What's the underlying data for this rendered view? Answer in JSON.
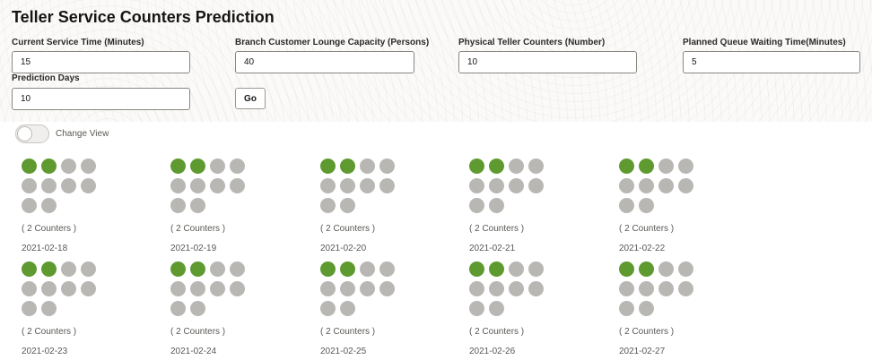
{
  "page": {
    "title": "Teller Service Counters Prediction"
  },
  "form": {
    "service_time": {
      "label": "Current Service Time (Minutes)",
      "value": "15"
    },
    "lounge_capacity": {
      "label": "Branch Customer Lounge Capacity (Persons)",
      "value": "40"
    },
    "teller_counters": {
      "label": "Physical Teller Counters (Number)",
      "value": "10"
    },
    "queue_wait": {
      "label": "Planned Queue Waiting Time(Minutes)",
      "value": "5"
    },
    "prediction_days": {
      "label": "Prediction Days",
      "value": "10"
    },
    "go_label": "Go"
  },
  "view_toggle": {
    "label": "Change View",
    "checked": false
  },
  "colors": {
    "active_counter": "#5f9a30",
    "inactive_counter": "#b9b7b4"
  },
  "predictions": [
    {
      "date": "2021-02-18",
      "counter_text": "( 2 Counters )",
      "active": 2,
      "total": 10
    },
    {
      "date": "2021-02-19",
      "counter_text": "( 2 Counters )",
      "active": 2,
      "total": 10
    },
    {
      "date": "2021-02-20",
      "counter_text": "( 2 Counters )",
      "active": 2,
      "total": 10
    },
    {
      "date": "2021-02-21",
      "counter_text": "( 2 Counters )",
      "active": 2,
      "total": 10
    },
    {
      "date": "2021-02-22",
      "counter_text": "( 2 Counters )",
      "active": 2,
      "total": 10
    },
    {
      "date": "2021-02-23",
      "counter_text": "( 2 Counters )",
      "active": 2,
      "total": 10
    },
    {
      "date": "2021-02-24",
      "counter_text": "( 2 Counters )",
      "active": 2,
      "total": 10
    },
    {
      "date": "2021-02-25",
      "counter_text": "( 2 Counters )",
      "active": 2,
      "total": 10
    },
    {
      "date": "2021-02-26",
      "counter_text": "( 2 Counters )",
      "active": 2,
      "total": 10
    },
    {
      "date": "2021-02-27",
      "counter_text": "( 2 Counters )",
      "active": 2,
      "total": 10
    }
  ]
}
